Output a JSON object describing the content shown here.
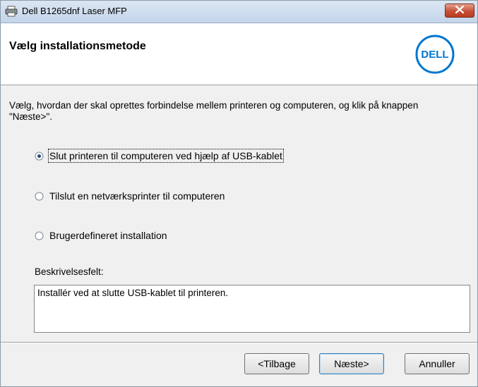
{
  "window": {
    "title": "Dell B1265dnf Laser MFP"
  },
  "header": {
    "title": "Vælg installationsmetode",
    "logo_text": "DELL"
  },
  "main": {
    "instruction": "Vælg, hvordan der skal oprettes forbindelse mellem printeren og computeren, og klik på knappen \"Næste>\".",
    "options": [
      {
        "label": "Slut printeren til computeren ved hjælp af USB-kablet",
        "selected": true
      },
      {
        "label": "Tilslut en netværksprinter til computeren",
        "selected": false
      },
      {
        "label": "Brugerdefineret installation",
        "selected": false
      }
    ],
    "description_label": "Beskrivelsesfelt:",
    "description_text": "Installér ved at slutte USB-kablet til printeren."
  },
  "footer": {
    "back_label": "<Tilbage",
    "next_label": "Næste>",
    "cancel_label": "Annuller"
  },
  "colors": {
    "dell_blue": "#0076ce",
    "close_red": "#c75037"
  }
}
